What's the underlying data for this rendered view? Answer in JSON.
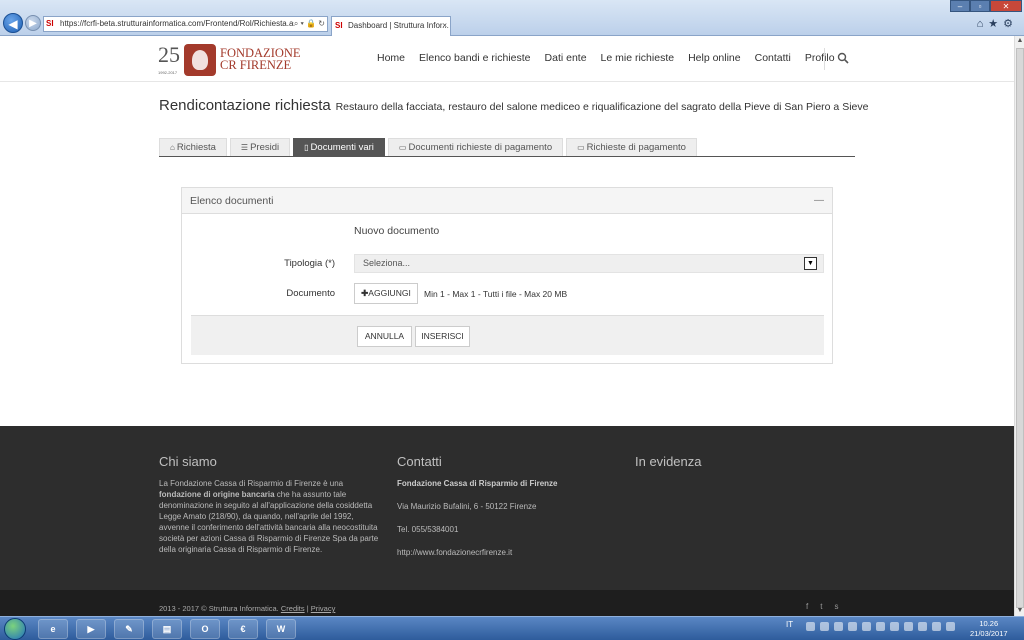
{
  "browser": {
    "url": "https://fcrfi-beta.strutturainformatica.com/Frontend/Rol/Richiesta.asp",
    "tab_title": "Dashboard | Struttura Infor...",
    "favicon": "SI"
  },
  "logo": {
    "number": "25",
    "years": "1992-2017",
    "line1": "FONDAZIONE",
    "line2": "CR FIRENZE"
  },
  "nav": {
    "items": [
      "Home",
      "Elenco bandi e richieste",
      "Dati ente",
      "Le mie richieste",
      "Help online",
      "Contatti",
      "Profilo"
    ]
  },
  "page": {
    "title": "Rendicontazione richiesta",
    "subtitle": "Restauro della facciata, restauro del salone mediceo e riqualificazione del sagrato della Pieve di San Piero a Sieve"
  },
  "tabs": [
    {
      "label": "Richiesta",
      "icon": "home-icon",
      "glyph": "⌂"
    },
    {
      "label": "Presidi",
      "icon": "list-icon",
      "glyph": "☰"
    },
    {
      "label": "Documenti vari",
      "icon": "file-icon",
      "glyph": "▯"
    },
    {
      "label": "Documenti richieste di pagamento",
      "icon": "payment-icon",
      "glyph": "▭"
    },
    {
      "label": "Richieste di pagamento",
      "icon": "payment-icon",
      "glyph": "▭"
    }
  ],
  "panel": {
    "title": "Elenco documenti",
    "collapse": "—",
    "form_title": "Nuovo documento",
    "tipologia_label": "Tipologia (*)",
    "tipologia_selected": "Seleziona...",
    "documento_label": "Documento",
    "add_button": "AGGIUNGI",
    "file_hint": "Min 1 - Max 1 - Tutti i file - Max 20 MB",
    "cancel_button": "ANNULLA",
    "insert_button": "INSERISCI"
  },
  "footer": {
    "col1_title": "Chi siamo",
    "col1_text_before": "La Fondazione Cassa di Risparmio di Firenze è una ",
    "col1_text_bold": "fondazione di origine bancaria",
    "col1_text_after": " che ha assunto tale denominazione in seguito al all'applicazione della cosiddetta Legge Amato (218/90), da quando, nell'aprile del 1992, avvenne il conferimento dell'attività bancaria alla neocostituita società per azioni Cassa di Risparmio di Firenze Spa da parte della originaria Cassa di Risparmio di Firenze.",
    "col2_title": "Contatti",
    "contact_name": "Fondazione Cassa di Risparmio di Firenze",
    "contact_address": "Via Maurizio Bufalini, 6 - 50122 Firenze",
    "contact_phone": "Tel. 055/5384001",
    "contact_site": "http://www.fondazionecrfirenze.it",
    "col3_title": "In evidenza",
    "copyright": "2013 - 2017 © Struttura Informatica.",
    "credits": "Credits",
    "separator": "|",
    "privacy": "Privacy"
  },
  "taskbar": {
    "language": "IT",
    "time": "10.26",
    "date": "21/03/2017"
  },
  "colors": {
    "brand": "#a33a2b",
    "active_tab": "#555555",
    "footer_bg": "#2d2d2d"
  }
}
